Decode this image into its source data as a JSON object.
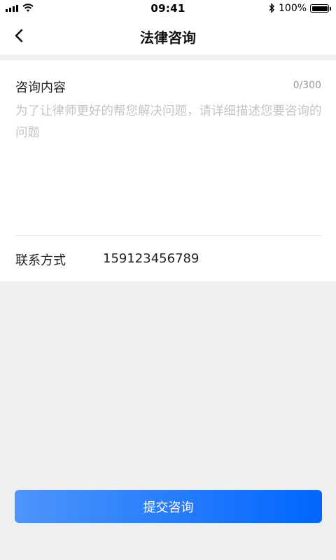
{
  "status_bar": {
    "time": "09:41",
    "battery_percent": "100%",
    "battery_level": 1.0,
    "signal_icon": "signal-bars-icon",
    "wifi_icon": "wifi-icon",
    "bluetooth_icon": "bluetooth-icon"
  },
  "nav": {
    "title": "法律咨询",
    "back_icon": "chevron-left-icon"
  },
  "form": {
    "content_label": "咨询内容",
    "counter": "0/300",
    "content_value": "",
    "content_placeholder": "为了让律师更好的帮您解决问题，请详细描述您要咨询的问题",
    "contact_label": "联系方式",
    "contact_value": "15912345678​9"
  },
  "submit": {
    "label": "提交咨询",
    "gradient_start": "#4f95fb",
    "gradient_end": "#0066ff"
  },
  "colors": {
    "background": "#efefef",
    "card": "#ffffff",
    "placeholder": "#c4c4c4"
  }
}
